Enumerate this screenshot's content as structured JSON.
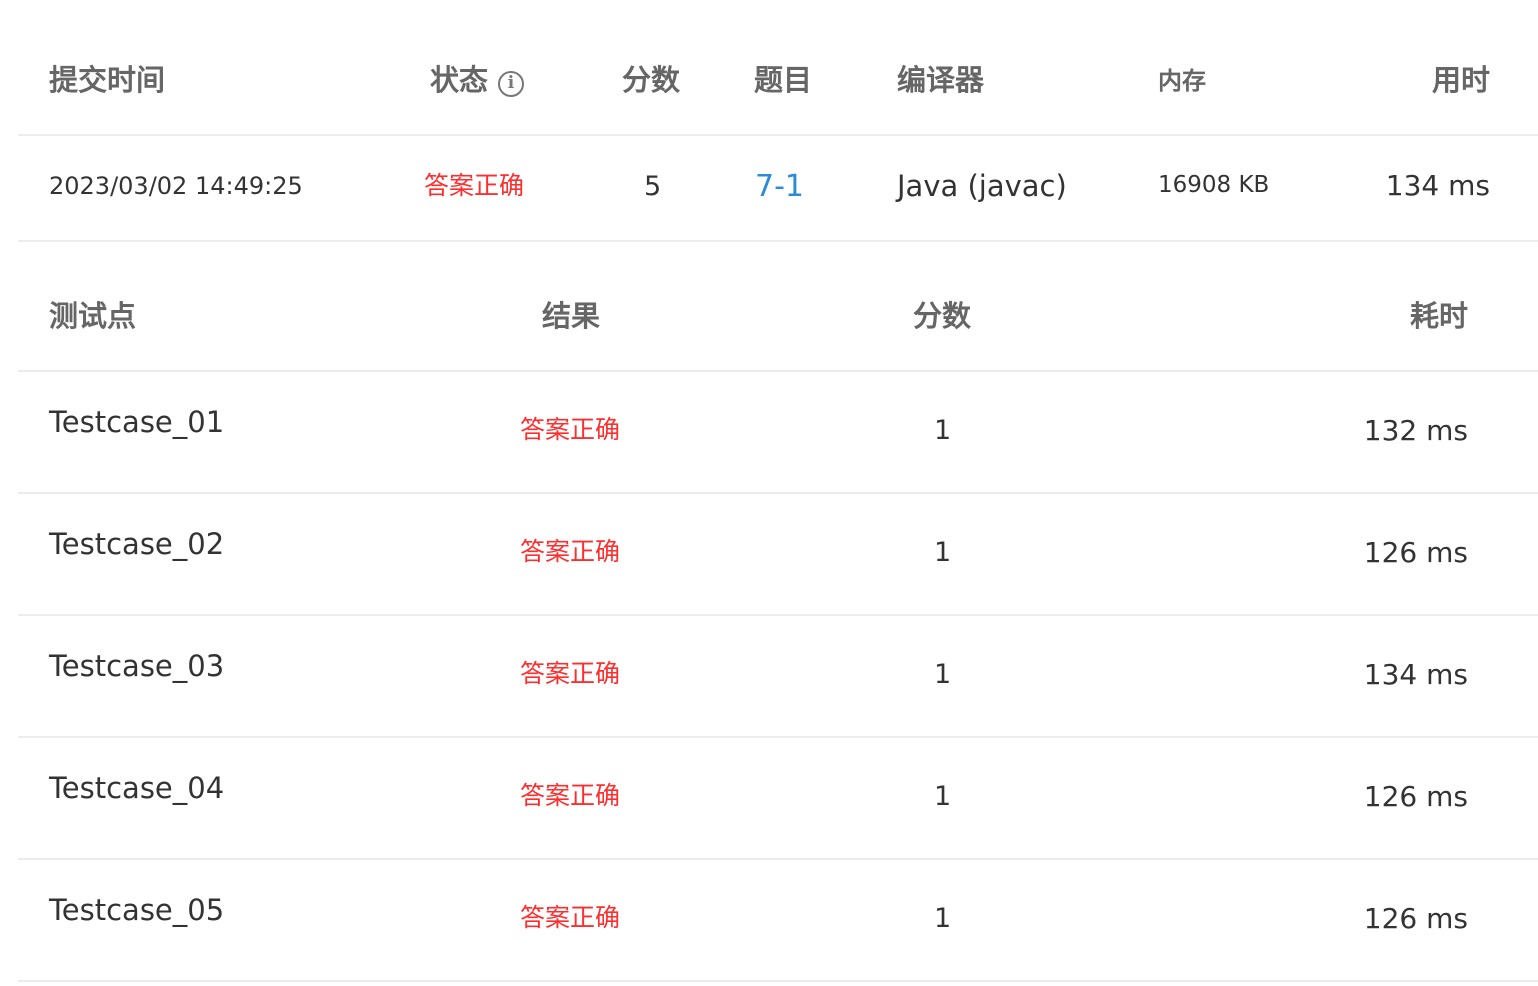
{
  "submission": {
    "headers": {
      "time": "提交时间",
      "status": "状态",
      "score": "分数",
      "problem": "题目",
      "compiler": "编译器",
      "memory": "内存",
      "duration": "用时"
    },
    "status_info_icon": "info-icon",
    "row": {
      "time": "2023/03/02 14:49:25",
      "status": "答案正确",
      "score": "5",
      "problem": "7-1",
      "compiler": "Java (javac)",
      "memory": "16908 KB",
      "duration": "134 ms"
    }
  },
  "testcases": {
    "headers": {
      "case": "测试点",
      "result": "结果",
      "score": "分数",
      "time": "耗时"
    },
    "rows": [
      {
        "name": "Testcase_01",
        "result": "答案正确",
        "score": "1",
        "time": "132 ms"
      },
      {
        "name": "Testcase_02",
        "result": "答案正确",
        "score": "1",
        "time": "126 ms"
      },
      {
        "name": "Testcase_03",
        "result": "答案正确",
        "score": "1",
        "time": "134 ms"
      },
      {
        "name": "Testcase_04",
        "result": "答案正确",
        "score": "1",
        "time": "126 ms"
      },
      {
        "name": "Testcase_05",
        "result": "答案正确",
        "score": "1",
        "time": "126 ms"
      }
    ]
  },
  "colors": {
    "accepted": "#ff2e2e",
    "link": "#2a8bd8",
    "header_text": "#666666",
    "body_text": "#333333",
    "divider": "#ececec"
  }
}
